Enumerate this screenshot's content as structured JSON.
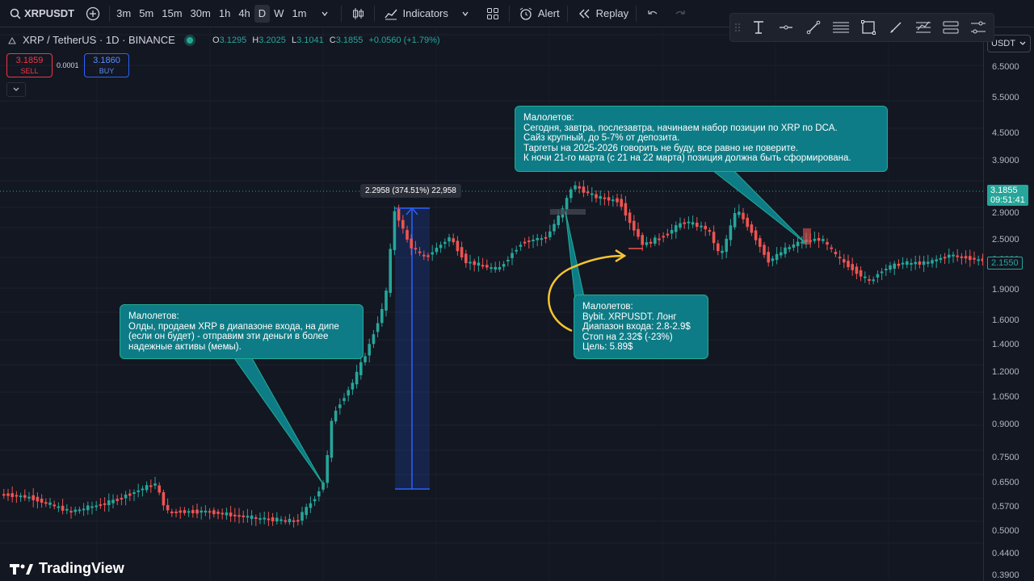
{
  "toolbar": {
    "symbol": "XRPUSDT",
    "timeframes": [
      "3m",
      "5m",
      "15m",
      "30m",
      "1h",
      "4h",
      "D",
      "W",
      "1m"
    ],
    "active_timeframe": "D",
    "indicators_label": "Indicators",
    "alert_label": "Alert",
    "replay_label": "Replay"
  },
  "legend": {
    "title": "XRP / TetherUS · 1D · BINANCE",
    "open_label": "O",
    "open": "3.1295",
    "high_label": "H",
    "high": "3.2025",
    "low_label": "L",
    "low": "3.1041",
    "close_label": "C",
    "close": "3.1855",
    "change": "+0.0560 (+1.79%)"
  },
  "trade": {
    "sell_price": "3.1859",
    "sell_label": "SELL",
    "spread": "0.0001",
    "buy_price": "3.1860",
    "buy_label": "BUY"
  },
  "price_axis": {
    "unit": "USDT",
    "ticks": [
      "6.5000",
      "5.5000",
      "4.5000",
      "3.9000",
      "3.2000",
      "2.9000",
      "2.5000",
      "2.2000",
      "1.9000",
      "1.6000",
      "1.4000",
      "1.2000",
      "1.0500",
      "0.9000",
      "0.7500",
      "0.6500",
      "0.5700",
      "0.5000",
      "0.4400",
      "0.3900"
    ],
    "current_price": "3.1855",
    "countdown": "09:51:41",
    "last_price_label": "2.1550"
  },
  "measure": {
    "label": "2.2958 (374.51%) 22,958"
  },
  "annotations": [
    {
      "id": "left",
      "text": "Малолетов:\nОлды, продаем XRP в диапазоне входа, на дипе (если он будет) - отправим эти деньги в более надежные активы (мемы)."
    },
    {
      "id": "top",
      "text": "Малолетов:\nСегодня, завтра, послезавтра, начинаем набор позиции по XRP по DCA.\nСайз крупный, до 5-7% от депозита.\nТаргеты на 2025-2026 говорить не буду, все равно не поверите.\nК ночи 21-го марта (с 21 на 22 марта) позиция должна быть сформирована."
    },
    {
      "id": "mid",
      "text": "Малолетов:\nBybit. XRPUSDT. Лонг\nДиапазон входа: 2.8-2.9$\nСтоп на 2.32$ (-23%)\nЦель: 5.89$"
    }
  ],
  "branding": {
    "logo": "TradingView"
  },
  "colors": {
    "up": "#26a69a",
    "down": "#ef5350",
    "bg": "#131722",
    "accent": "#2962ff",
    "callout": "#0e7c86"
  }
}
